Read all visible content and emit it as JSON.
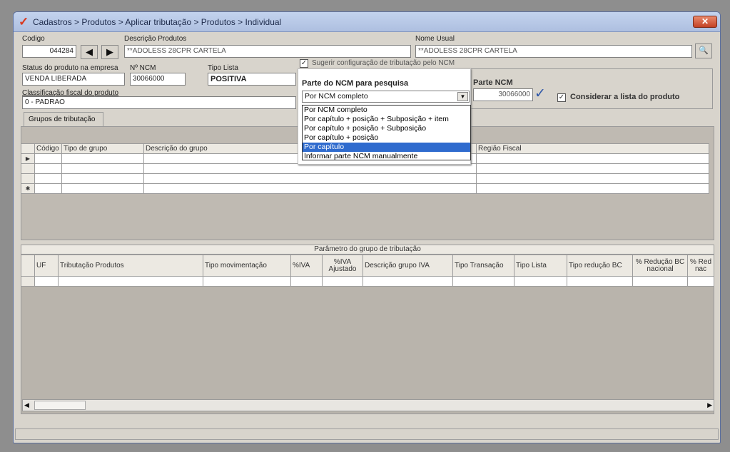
{
  "window": {
    "title": "Cadastros > Produtos > Aplicar tributação > Produtos > Individual",
    "close_label": "✕"
  },
  "form": {
    "codigo_label": "Codigo",
    "codigo_value": "044284",
    "descricao_label": "Descrição Produtos",
    "descricao_value": "**ADOLESS 28CPR CARTELA",
    "nome_usual_label": "Nome Usual",
    "nome_usual_value": "**ADOLESS 28CPR CARTELA",
    "status_label": "Status do produto na empresa",
    "status_value": "VENDA LIBERADA",
    "ncm_label": "Nº NCM",
    "ncm_value": "30066000",
    "tipo_lista_label": "Tipo Lista",
    "tipo_lista_value": "POSITIVA",
    "classificacao_label": "Classificação fiscal do produto",
    "classificacao_value": "0 - PADRAO",
    "sugerir_label": "Sugerir configuração de tributação pelo NCM",
    "parte_ncm_pesquisa_label": "Parte do NCM para pesquisa",
    "parte_ncm_pesquisa_value": "Por NCM completo",
    "parte_ncm_label": "Parte NCM",
    "parte_ncm_value": "30066000",
    "considerar_label": "Considerar a lista do produto"
  },
  "dropdown": {
    "options": [
      "Por NCM completo",
      "Por capítulo + posição + Subposição + item",
      "Por capítulo + posição + Subposição",
      "Por capítulo + posição",
      "Por capítulo",
      "Informar parte NCM manualmente"
    ],
    "selected_index": 4
  },
  "tabs": {
    "grupos": "Grupos de tributação"
  },
  "grid1": {
    "columns": [
      "Código",
      "Tipo de grupo",
      "Descrição do grupo",
      "Região Fiscal"
    ]
  },
  "grid2": {
    "title": "Parâmetro do grupo de tributação",
    "columns": [
      "UF",
      "Tributação Produtos",
      "Tipo movimentação",
      "%IVA",
      "%IVA Ajustado",
      "Descrição grupo IVA",
      "Tipo Transação",
      "Tipo Lista",
      "Tipo redução BC",
      "% Redução BC nacional",
      "% Red nac"
    ]
  },
  "colors": {
    "selection": "#2f6bce",
    "title_check": "#d9381e"
  }
}
